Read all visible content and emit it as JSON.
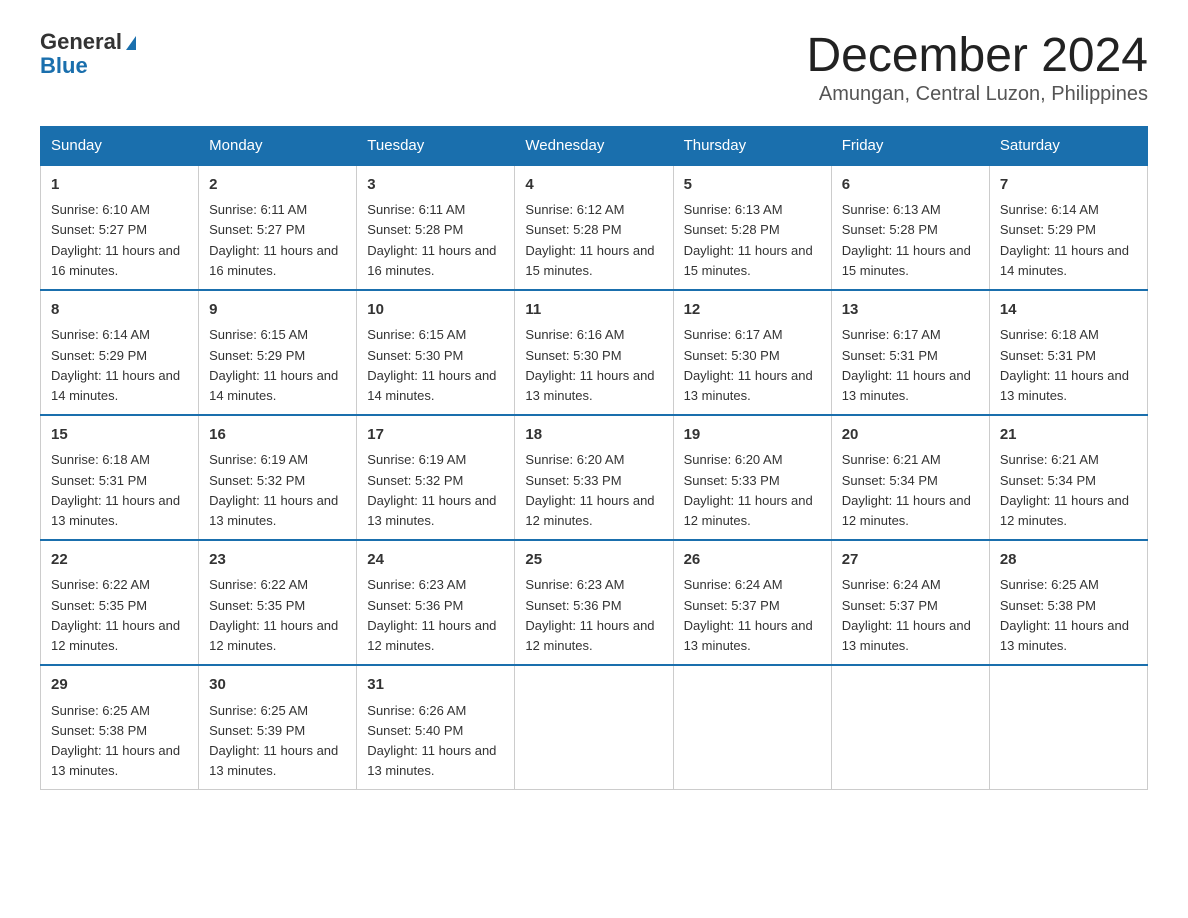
{
  "header": {
    "logo_general": "General",
    "logo_blue": "Blue",
    "title": "December 2024",
    "subtitle": "Amungan, Central Luzon, Philippines"
  },
  "days_of_week": [
    "Sunday",
    "Monday",
    "Tuesday",
    "Wednesday",
    "Thursday",
    "Friday",
    "Saturday"
  ],
  "weeks": [
    [
      {
        "day": "1",
        "sunrise": "6:10 AM",
        "sunset": "5:27 PM",
        "daylight": "11 hours and 16 minutes."
      },
      {
        "day": "2",
        "sunrise": "6:11 AM",
        "sunset": "5:27 PM",
        "daylight": "11 hours and 16 minutes."
      },
      {
        "day": "3",
        "sunrise": "6:11 AM",
        "sunset": "5:28 PM",
        "daylight": "11 hours and 16 minutes."
      },
      {
        "day": "4",
        "sunrise": "6:12 AM",
        "sunset": "5:28 PM",
        "daylight": "11 hours and 15 minutes."
      },
      {
        "day": "5",
        "sunrise": "6:13 AM",
        "sunset": "5:28 PM",
        "daylight": "11 hours and 15 minutes."
      },
      {
        "day": "6",
        "sunrise": "6:13 AM",
        "sunset": "5:28 PM",
        "daylight": "11 hours and 15 minutes."
      },
      {
        "day": "7",
        "sunrise": "6:14 AM",
        "sunset": "5:29 PM",
        "daylight": "11 hours and 14 minutes."
      }
    ],
    [
      {
        "day": "8",
        "sunrise": "6:14 AM",
        "sunset": "5:29 PM",
        "daylight": "11 hours and 14 minutes."
      },
      {
        "day": "9",
        "sunrise": "6:15 AM",
        "sunset": "5:29 PM",
        "daylight": "11 hours and 14 minutes."
      },
      {
        "day": "10",
        "sunrise": "6:15 AM",
        "sunset": "5:30 PM",
        "daylight": "11 hours and 14 minutes."
      },
      {
        "day": "11",
        "sunrise": "6:16 AM",
        "sunset": "5:30 PM",
        "daylight": "11 hours and 13 minutes."
      },
      {
        "day": "12",
        "sunrise": "6:17 AM",
        "sunset": "5:30 PM",
        "daylight": "11 hours and 13 minutes."
      },
      {
        "day": "13",
        "sunrise": "6:17 AM",
        "sunset": "5:31 PM",
        "daylight": "11 hours and 13 minutes."
      },
      {
        "day": "14",
        "sunrise": "6:18 AM",
        "sunset": "5:31 PM",
        "daylight": "11 hours and 13 minutes."
      }
    ],
    [
      {
        "day": "15",
        "sunrise": "6:18 AM",
        "sunset": "5:31 PM",
        "daylight": "11 hours and 13 minutes."
      },
      {
        "day": "16",
        "sunrise": "6:19 AM",
        "sunset": "5:32 PM",
        "daylight": "11 hours and 13 minutes."
      },
      {
        "day": "17",
        "sunrise": "6:19 AM",
        "sunset": "5:32 PM",
        "daylight": "11 hours and 13 minutes."
      },
      {
        "day": "18",
        "sunrise": "6:20 AM",
        "sunset": "5:33 PM",
        "daylight": "11 hours and 12 minutes."
      },
      {
        "day": "19",
        "sunrise": "6:20 AM",
        "sunset": "5:33 PM",
        "daylight": "11 hours and 12 minutes."
      },
      {
        "day": "20",
        "sunrise": "6:21 AM",
        "sunset": "5:34 PM",
        "daylight": "11 hours and 12 minutes."
      },
      {
        "day": "21",
        "sunrise": "6:21 AM",
        "sunset": "5:34 PM",
        "daylight": "11 hours and 12 minutes."
      }
    ],
    [
      {
        "day": "22",
        "sunrise": "6:22 AM",
        "sunset": "5:35 PM",
        "daylight": "11 hours and 12 minutes."
      },
      {
        "day": "23",
        "sunrise": "6:22 AM",
        "sunset": "5:35 PM",
        "daylight": "11 hours and 12 minutes."
      },
      {
        "day": "24",
        "sunrise": "6:23 AM",
        "sunset": "5:36 PM",
        "daylight": "11 hours and 12 minutes."
      },
      {
        "day": "25",
        "sunrise": "6:23 AM",
        "sunset": "5:36 PM",
        "daylight": "11 hours and 12 minutes."
      },
      {
        "day": "26",
        "sunrise": "6:24 AM",
        "sunset": "5:37 PM",
        "daylight": "11 hours and 13 minutes."
      },
      {
        "day": "27",
        "sunrise": "6:24 AM",
        "sunset": "5:37 PM",
        "daylight": "11 hours and 13 minutes."
      },
      {
        "day": "28",
        "sunrise": "6:25 AM",
        "sunset": "5:38 PM",
        "daylight": "11 hours and 13 minutes."
      }
    ],
    [
      {
        "day": "29",
        "sunrise": "6:25 AM",
        "sunset": "5:38 PM",
        "daylight": "11 hours and 13 minutes."
      },
      {
        "day": "30",
        "sunrise": "6:25 AM",
        "sunset": "5:39 PM",
        "daylight": "11 hours and 13 minutes."
      },
      {
        "day": "31",
        "sunrise": "6:26 AM",
        "sunset": "5:40 PM",
        "daylight": "11 hours and 13 minutes."
      },
      null,
      null,
      null,
      null
    ]
  ]
}
